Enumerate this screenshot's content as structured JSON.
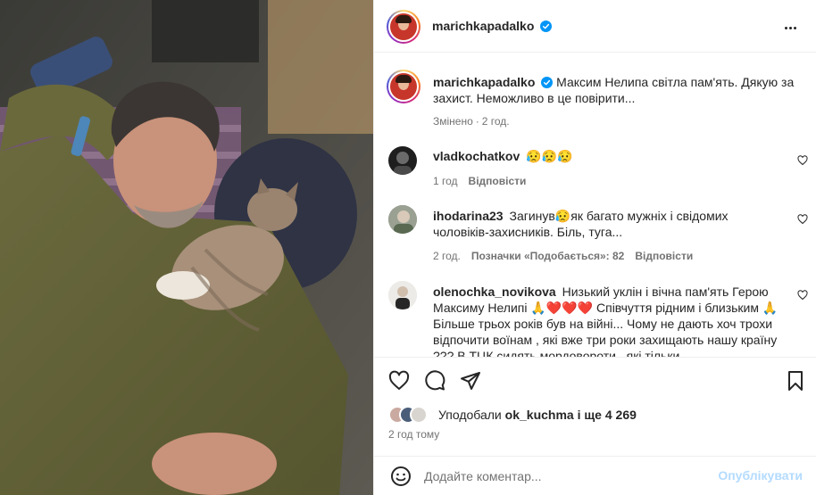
{
  "post": {
    "username": "marichkapadalko",
    "more_label": "..."
  },
  "caption": {
    "username": "marichkapadalko",
    "text": "Максим Нелипа світла пам'ять. Дякую за захист. Неможливо в це повірити...",
    "edited": "Змінено",
    "sep": "·",
    "time": "2 год."
  },
  "comments": [
    {
      "username": "vladkochatkov",
      "text": "😥😥😥",
      "time": "1 год",
      "reply": "Відповісти"
    },
    {
      "username": "ihodarina23",
      "text": "Загинув😥як багато мужніх і свідомих чоловіків-захисників. Біль, туга...",
      "time": "2 год.",
      "likes": "Позначки «Подобається»: 82",
      "reply": "Відповісти"
    },
    {
      "username": "olenochka_novikova",
      "text": "Низький уклін і вічна пам'ять Герою Максиму Нелипі 🙏❤️❤️❤️ Співчуття рідним і близьким 🙏 Більше трьох років був на війні... Чому не дають хоч трохи відпочити воїнам , які вже три роки захищають нашу країну ??? В ТЦК сидять мордовороти , які тільки"
    }
  ],
  "likes": {
    "prefix": "Уподобали",
    "user": "ok_kuchma",
    "suffix": "і ще 4 269"
  },
  "time_ago": "2 год тому",
  "comment_box": {
    "placeholder": "Додайте коментар...",
    "publish": "Опублікувати"
  },
  "colors": {
    "verified": "#0095f6",
    "publish_disabled": "#b3dbff",
    "muted": "#737373"
  }
}
